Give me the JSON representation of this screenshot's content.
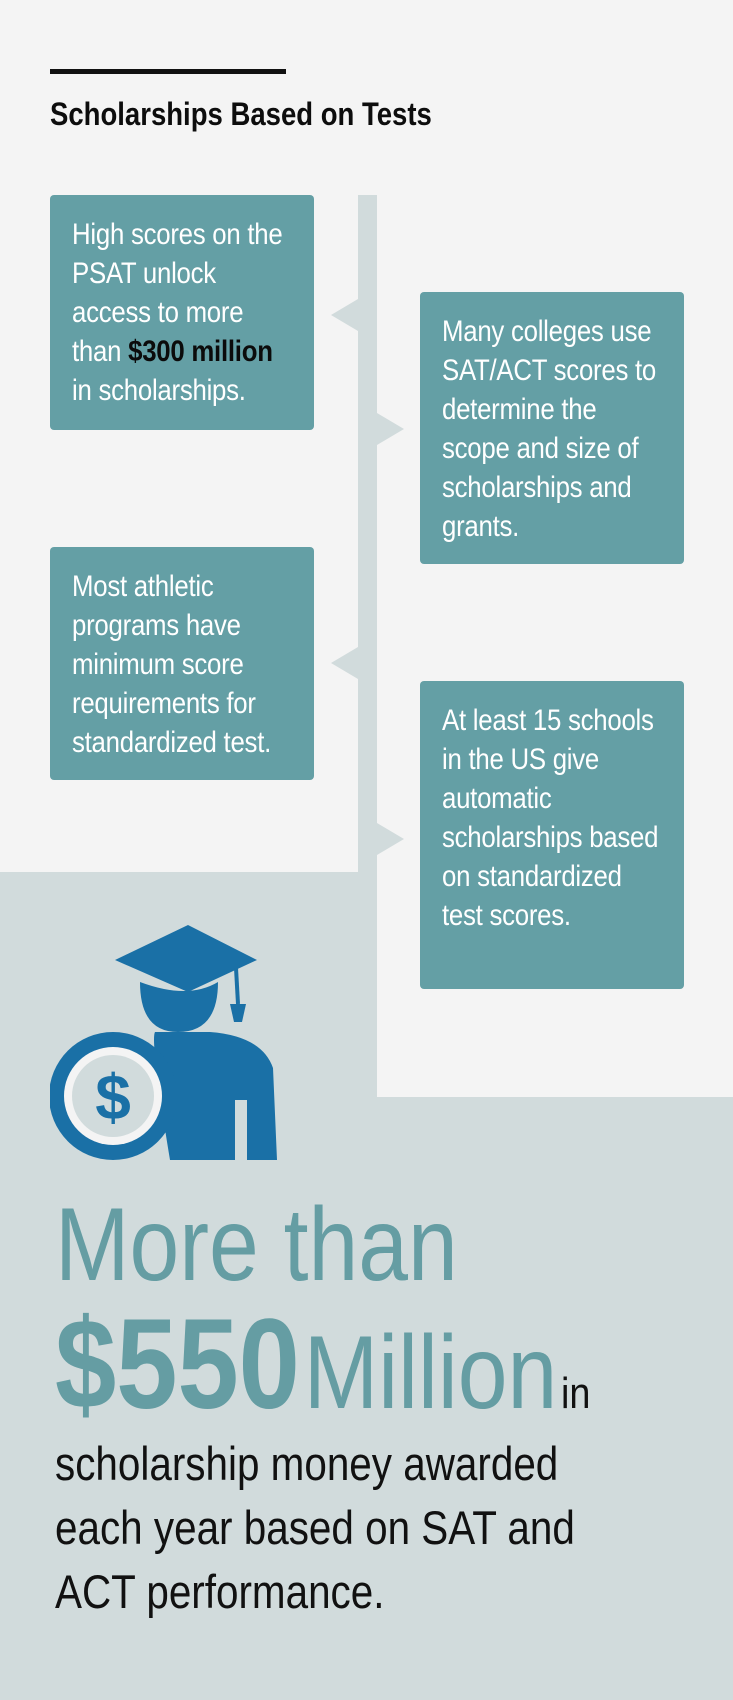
{
  "header": {
    "title": "Scholarships Based on Tests"
  },
  "cards": {
    "c1": {
      "pre": "High scores on the PSAT unlock access to more than ",
      "bold": "$300 million",
      "post": " in scholarships."
    },
    "c2": {
      "text": "Many colleges use SAT/ACT scores to determine the scope and size of scholarships and grants."
    },
    "c3": {
      "text": "Most athletic programs have minimum score requirements for standardized test."
    },
    "c4": {
      "text": "At least 15 schools in the US give automatic scholarships based on standardized test scores."
    }
  },
  "stat": {
    "line1": "More than",
    "amount": "$550",
    "unit": "Million",
    "connector": "in",
    "description": "scholarship money awarded each year based on SAT and ACT performance."
  },
  "icons": {
    "graduate": "graduate-with-dollar-coin-icon",
    "dollar_symbol": "$"
  },
  "colors": {
    "card": "#649fa5",
    "icon_blue": "#1a70a6",
    "background_light": "#f4f4f4",
    "background_grey": "#d1dbdc",
    "stat_teal": "#659da3"
  }
}
